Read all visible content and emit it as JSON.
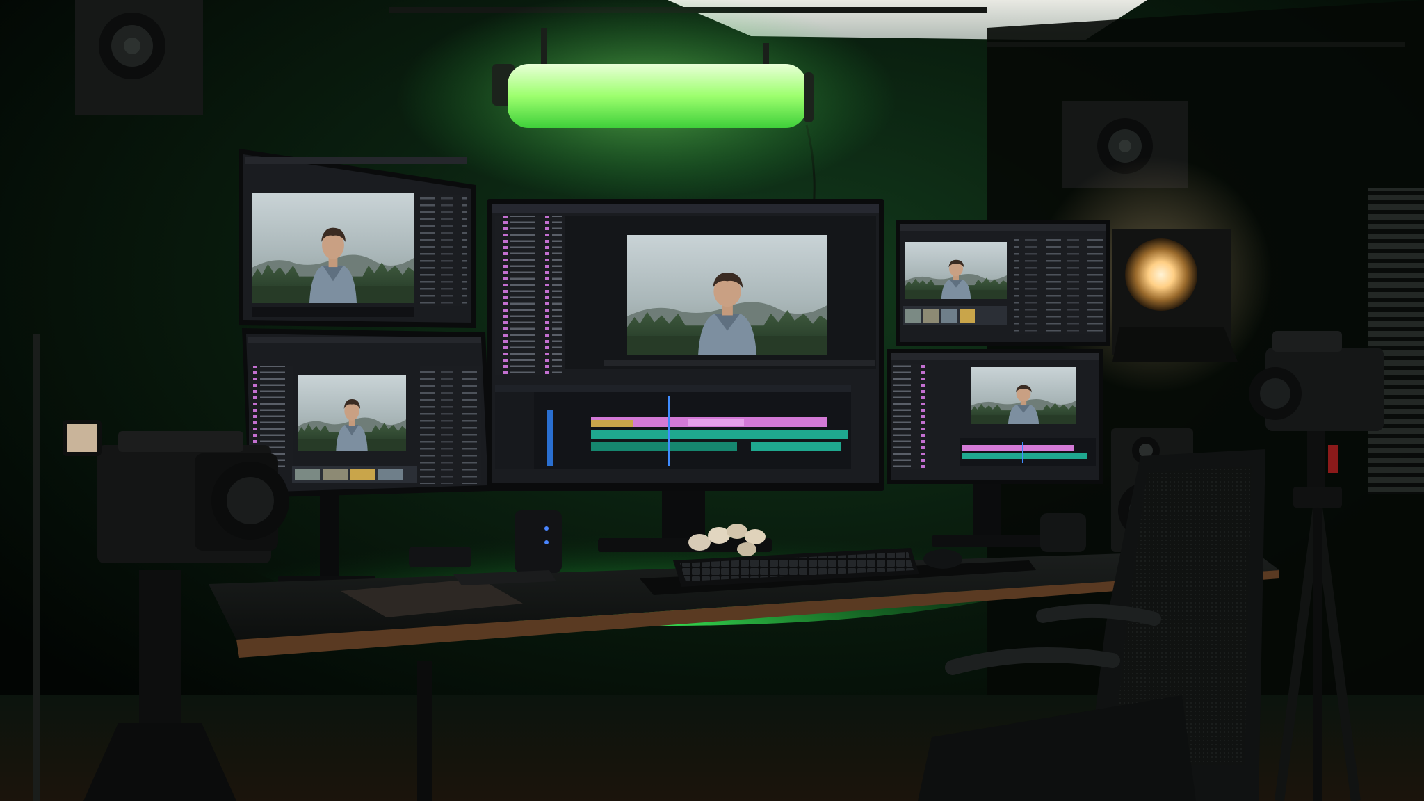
{
  "monitor_brand": {
    "top_left": "",
    "bottom_left": "",
    "center": "",
    "bottom_right": ""
  },
  "colors": {
    "ambient_green": "#2fd04a",
    "light_bar": "#8dff70",
    "wall": "#07110a",
    "desk": "#121413",
    "desk_edge": "#5a3a22",
    "editor_panel": "#1b1d21",
    "timeline_teal": "#1fa88f",
    "timeline_pink": "#d37ad6",
    "timeline_gold": "#c9a54a",
    "playhead_blue": "#3f8cff",
    "spotlight": "#ffd9a0"
  },
  "icons": {
    "light_bar": "led-tube-light-icon",
    "spot": "fresnel-spotlight-icon",
    "camera": "cinema-camera-icon",
    "speaker": "studio-monitor-speaker-icon",
    "keyboard": "keyboard-icon",
    "mouse": "mouse-icon",
    "chair": "office-chair-icon"
  }
}
